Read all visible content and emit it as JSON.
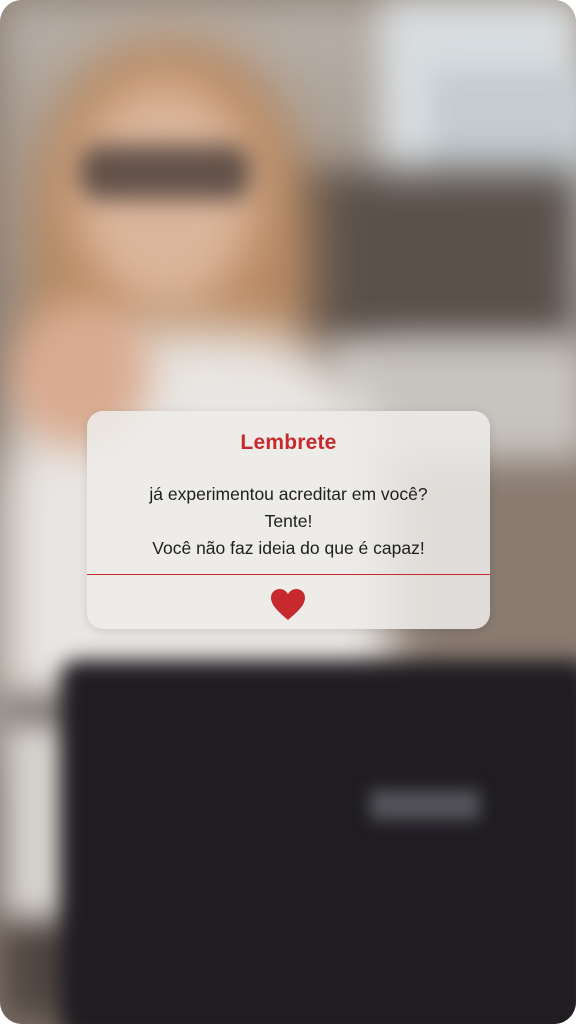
{
  "card": {
    "title": "Lembrete",
    "lines": [
      "já experimentou acreditar em você?",
      "Tente!",
      "Você não faz ideia do que é capaz!"
    ],
    "accent_color": "#c62a2f",
    "icon": "heart-icon"
  },
  "background": {
    "description_icon": "blurred-photo"
  }
}
